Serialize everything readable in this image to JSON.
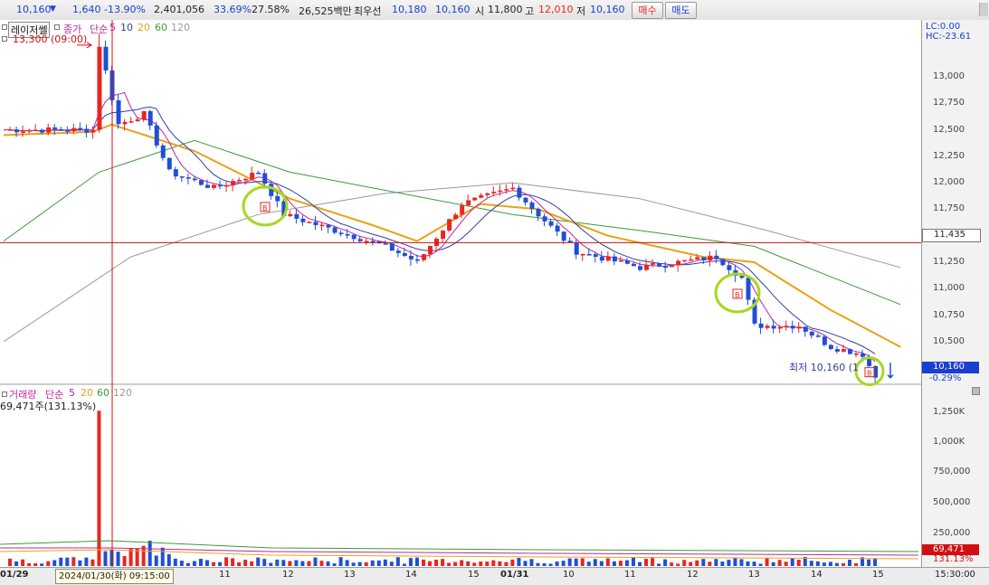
{
  "topbar": {
    "price": "10,160",
    "down_arrow": "▼",
    "change": "1,640",
    "change_pct": "-13.90%",
    "volume": "2,401,056",
    "ratio1": "33.69%",
    "ratio2": "27.58%",
    "amount": "26,525백만",
    "ask_label": "최우선",
    "best_ask": "10,180",
    "best_bid": "10,160",
    "open_label": "시",
    "open": "11,800",
    "high_label": "고",
    "high": "12,010",
    "low_label": "저",
    "low": "10,160",
    "buy_label": "매수",
    "sell_label": "매도"
  },
  "price_legend": {
    "laser": "레이저쎌",
    "close_label": "종가",
    "simple_label": "단순",
    "ma5_label": "5",
    "ma10_label": "10",
    "ma20_label": "20",
    "ma60_label": "60",
    "ma120_label": "120",
    "high_marker": "13,300 (09:00)"
  },
  "volume_legend": {
    "label": "거래량",
    "simple_label": "단순",
    "ma5_label": "5",
    "ma20_label": "20",
    "ma60_label": "60",
    "ma120_label": "120",
    "value": "69,471주(131.13%)"
  },
  "right_axis": {
    "lc": "LC:0.00",
    "hc": "HC:-23.61",
    "crosshair_price": "11,435",
    "current_price": "10,160",
    "current_pct": "-0.29%",
    "current_volume": "69,471",
    "current_volume_pct": "131.13%",
    "volume_ticks": [
      "1,250K",
      "1,000K",
      "750,000",
      "500,000",
      "250,000"
    ]
  },
  "low_annotation": "최저 10,160 (1",
  "signal_label": "B",
  "date_axis": {
    "labels": [
      "01/29",
      "11",
      "12",
      "13",
      "14",
      "15",
      "01/31",
      "10",
      "11",
      "12",
      "13",
      "14",
      "15"
    ],
    "cursor_date": "2024/01/30(화) 09:15:00",
    "time": "15:30:00"
  },
  "colors": {
    "up": "#e8261f",
    "down": "#1f4fd6",
    "ma5": "#c0269b",
    "ma10": "#2f3fa8",
    "ma20": "#e8a21a",
    "ma60": "#3a9a3a",
    "ma120": "#9a9a9a",
    "signal_circle": "#a8d81e",
    "crosshair": "#d01010"
  },
  "chart_data": {
    "type": "line",
    "title": "레이저쎌",
    "y_ticks": [
      "13,000",
      "12,750",
      "12,500",
      "12,250",
      "12,000",
      "11,750",
      "11,500",
      "11,250",
      "11,000",
      "10,750",
      "10,500",
      "10,250"
    ],
    "ylim": [
      10140,
      13410
    ],
    "volume_ylim": [
      0,
      1500000
    ],
    "x_labels": [
      "01/29",
      "11",
      "12",
      "13",
      "14",
      "15",
      "01/31",
      "10",
      "11",
      "12",
      "13",
      "14",
      "15"
    ],
    "price_checkpoints": [
      {
        "i": 0,
        "close": 12500
      },
      {
        "i": 14,
        "close": 12500
      },
      {
        "i": 15,
        "close": 13300
      },
      {
        "i": 18,
        "close": 12550
      },
      {
        "i": 22,
        "close": 12650
      },
      {
        "i": 26,
        "close": 12100
      },
      {
        "i": 33,
        "close": 11950
      },
      {
        "i": 40,
        "close": 12100
      },
      {
        "i": 44,
        "close": 11700
      },
      {
        "i": 52,
        "close": 11550
      },
      {
        "i": 60,
        "close": 11400
      },
      {
        "i": 65,
        "close": 11250
      },
      {
        "i": 72,
        "close": 11800
      },
      {
        "i": 80,
        "close": 11950
      },
      {
        "i": 84,
        "close": 11700
      },
      {
        "i": 90,
        "close": 11350
      },
      {
        "i": 100,
        "close": 11200
      },
      {
        "i": 112,
        "close": 11300
      },
      {
        "i": 116,
        "close": 11100
      },
      {
        "i": 118,
        "close": 10650
      },
      {
        "i": 125,
        "close": 10650
      },
      {
        "i": 130,
        "close": 10450
      },
      {
        "i": 135,
        "close": 10380
      },
      {
        "i": 137,
        "close": 10160
      }
    ],
    "ma20_points": [
      [
        0,
        12450
      ],
      [
        14,
        12480
      ],
      [
        17,
        12550
      ],
      [
        30,
        12300
      ],
      [
        45,
        11850
      ],
      [
        58,
        11600
      ],
      [
        65,
        11450
      ],
      [
        75,
        11800
      ],
      [
        84,
        11750
      ],
      [
        95,
        11500
      ],
      [
        110,
        11300
      ],
      [
        118,
        11250
      ],
      [
        130,
        10800
      ],
      [
        141,
        10450
      ]
    ],
    "ma60_points": [
      [
        0,
        11450
      ],
      [
        15,
        12100
      ],
      [
        30,
        12400
      ],
      [
        45,
        12100
      ],
      [
        80,
        11700
      ],
      [
        100,
        11550
      ],
      [
        118,
        11400
      ],
      [
        141,
        10850
      ]
    ],
    "ma120_points": [
      [
        0,
        10500
      ],
      [
        20,
        11300
      ],
      [
        40,
        11700
      ],
      [
        60,
        11900
      ],
      [
        80,
        12000
      ],
      [
        100,
        11850
      ],
      [
        120,
        11550
      ],
      [
        141,
        11200
      ]
    ],
    "volume_spike": {
      "i": 15,
      "volume": 1370000
    },
    "current": {
      "close": 10160,
      "volume": 69471
    }
  }
}
